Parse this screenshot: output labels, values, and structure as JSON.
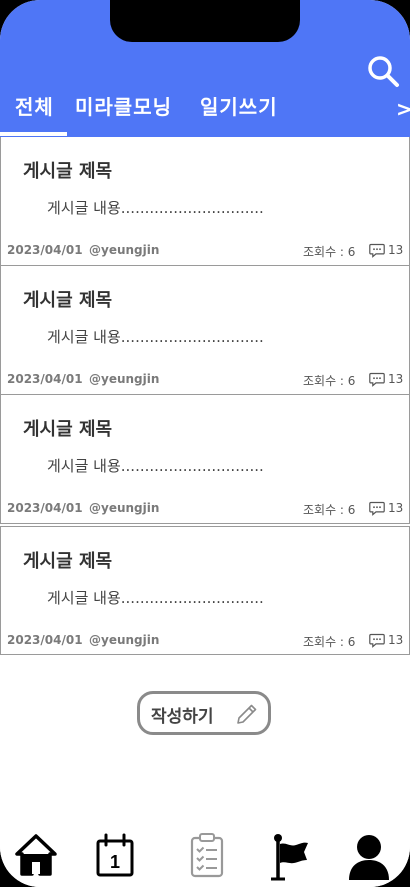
{
  "header": {
    "tabs": [
      {
        "label": "전체"
      },
      {
        "label": "미라클모닝"
      },
      {
        "label": "일기쓰기"
      }
    ],
    "more_label": ">"
  },
  "posts": [
    {
      "title": "게시글 제목",
      "body": "게시글 내용..............................",
      "date": "2023/04/01",
      "author": "@yeungjin",
      "views": "조회수 : 6",
      "comments": "13"
    },
    {
      "title": "게시글 제목",
      "body": "게시글 내용..............................",
      "date": "2023/04/01",
      "author": "@yeungjin",
      "views": "조회수 : 6",
      "comments": "13"
    },
    {
      "title": "게시글 제목",
      "body": "게시글 내용..............................",
      "date": "2023/04/01",
      "author": "@yeungjin",
      "views": "조회수 : 6",
      "comments": "13"
    },
    {
      "title": "게시글 제목",
      "body": "게시글 내용..............................",
      "date": "2023/04/01",
      "author": "@yeungjin",
      "views": "조회수 : 6",
      "comments": "13"
    }
  ],
  "write_button": {
    "label": "작성하기"
  },
  "calendar_day": "1",
  "colors": {
    "header": "#4f76f6",
    "border": "#9a9a9a"
  },
  "icons": {
    "search": "search-icon",
    "comment": "comment-icon",
    "pencil": "pencil-icon",
    "nav": [
      "home-icon",
      "calendar-icon",
      "checklist-icon",
      "flag-icon",
      "user-icon"
    ]
  }
}
